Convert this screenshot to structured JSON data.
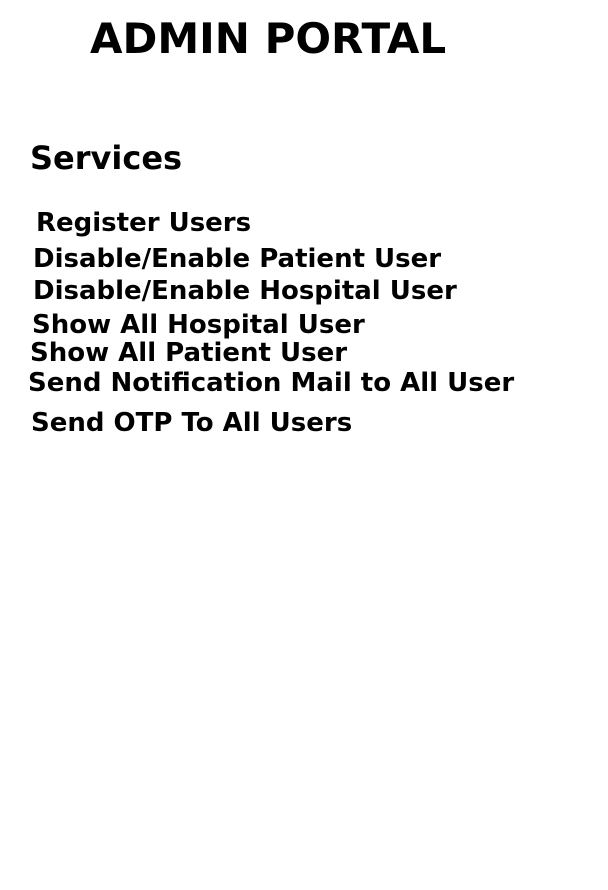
{
  "header": {
    "title": "ADMIN PORTAL"
  },
  "services": {
    "heading": "Services",
    "items": [
      {
        "label": "Register Users"
      },
      {
        "label": "Disable/Enable Patient User"
      },
      {
        "label": "Disable/Enable Hospital User"
      },
      {
        "label": "Show All Hospital User"
      },
      {
        "label": "Show All Patient User"
      },
      {
        "label": "Send Notification Mail to All User"
      },
      {
        "label": "Send OTP To All Users"
      }
    ]
  }
}
